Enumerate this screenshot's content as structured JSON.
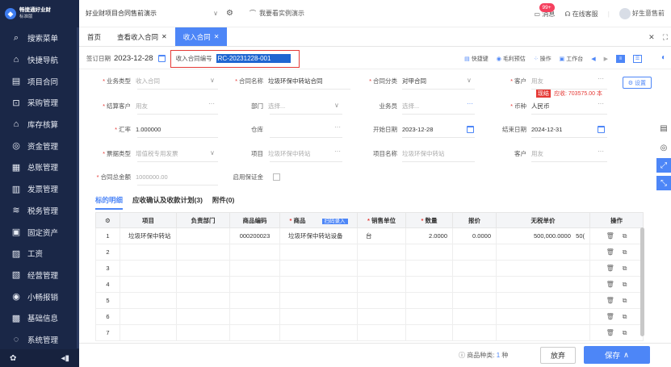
{
  "sidebar": {
    "logo_title": "畅捷通好业财",
    "logo_sub": "标准版",
    "items": [
      {
        "label": "搜索菜单",
        "icon": "search-icon"
      },
      {
        "label": "快捷导航",
        "icon": "home-icon"
      },
      {
        "label": "项目合同",
        "icon": "document-icon"
      },
      {
        "label": "采购管理",
        "icon": "cart-icon"
      },
      {
        "label": "库存核算",
        "icon": "warehouse-icon"
      },
      {
        "label": "资金管理",
        "icon": "coin-icon"
      },
      {
        "label": "总账管理",
        "icon": "ledger-icon"
      },
      {
        "label": "发票管理",
        "icon": "invoice-icon"
      },
      {
        "label": "税务管理",
        "icon": "tax-icon"
      },
      {
        "label": "固定资产",
        "icon": "asset-icon"
      },
      {
        "label": "工资",
        "icon": "salary-icon"
      },
      {
        "label": "经营管理",
        "icon": "report-icon"
      },
      {
        "label": "小畅报销",
        "icon": "reimburse-icon"
      },
      {
        "label": "基础信息",
        "icon": "info-icon"
      },
      {
        "label": "系统管理",
        "icon": "system-icon"
      }
    ]
  },
  "topbar": {
    "company": "好业财项目合同售前演示",
    "demo_link": "我要看实例演示",
    "messages": "消息",
    "message_badge": "99+",
    "service": "在线客服",
    "user": "好生意售前"
  },
  "tabs": [
    {
      "label": "首页",
      "active": false,
      "closable": false
    },
    {
      "label": "查看收入合同",
      "active": false,
      "closable": true
    },
    {
      "label": "收入合同",
      "active": true,
      "closable": true
    }
  ],
  "header": {
    "sign_date_label": "签订日期",
    "sign_date": "2023-12-28",
    "contract_no_label": "收入合同编号",
    "contract_no": "RC-20231228-001",
    "shortcut": "快捷键",
    "margin_estimate": "毛利预估",
    "operations": "操作",
    "workbench": "工作台"
  },
  "form": {
    "business_type": {
      "label": "业务类型",
      "value": "收入合同",
      "placeholder": true
    },
    "contract_name": {
      "label": "合同名称",
      "value": "垃圾环保中转站合同"
    },
    "contract_category": {
      "label": "合同分类",
      "value": "对甲合同"
    },
    "customer": {
      "label": "客户",
      "value": "用友",
      "placeholder": true
    },
    "settings_button": "设置",
    "settle_customer": {
      "label": "结算客户",
      "value": "用友",
      "placeholder": true
    },
    "department": {
      "label": "部门",
      "value": "选择...",
      "placeholder": true
    },
    "salesperson": {
      "label": "业务员",
      "value": "选择...",
      "placeholder": true
    },
    "currency": {
      "label": "币种",
      "value": "人民币"
    },
    "aux_tag": "现结",
    "aux_text": "应收: 703575.00 本",
    "exchange_rate": {
      "label": "汇率",
      "value": "1.000000"
    },
    "warehouse": {
      "label": "仓库",
      "value": ""
    },
    "start_date": {
      "label": "开始日期",
      "value": "2023-12-28"
    },
    "end_date": {
      "label": "结束日期",
      "value": "2024-12-31"
    },
    "invoice_type": {
      "label": "票据类型",
      "value": "增值税专用发票",
      "placeholder": true
    },
    "project": {
      "label": "项目",
      "value": "垃圾环保中转站",
      "placeholder": true
    },
    "project_name": {
      "label": "项目名称",
      "value": "垃圾环保中转站",
      "placeholder": true
    },
    "customer2": {
      "label": "客户",
      "value": "用友",
      "placeholder": true
    },
    "total_amount": {
      "label": "合同总金额",
      "value": "1000000.00",
      "placeholder": true
    },
    "deposit": {
      "label": "启用保证金"
    }
  },
  "subtabs": [
    "标的明细",
    "应收确认及收款计划(3)",
    "附件(0)"
  ],
  "grid": {
    "columns": [
      "",
      "项目",
      "负责部门",
      "商品编码",
      "商品",
      "销售单位",
      "数量",
      "报价",
      "无税单价",
      "操作"
    ],
    "scan_button": "扫码录入",
    "rows": [
      {
        "n": "1",
        "project": "垃圾环保中转站",
        "dept": "",
        "code": "000200023",
        "product": "垃圾环保中转站设备",
        "unit": "台",
        "qty": "2.0000",
        "price": "0.0000",
        "net_price": "500,000.0000",
        "extra": "50("
      },
      {
        "n": "2"
      },
      {
        "n": "3"
      },
      {
        "n": "4"
      },
      {
        "n": "5"
      },
      {
        "n": "6"
      },
      {
        "n": "7"
      }
    ]
  },
  "footer": {
    "product_count_label": "商品种类:",
    "product_count": "1",
    "product_count_unit": "种",
    "discard": "放弃",
    "save": "保存"
  }
}
